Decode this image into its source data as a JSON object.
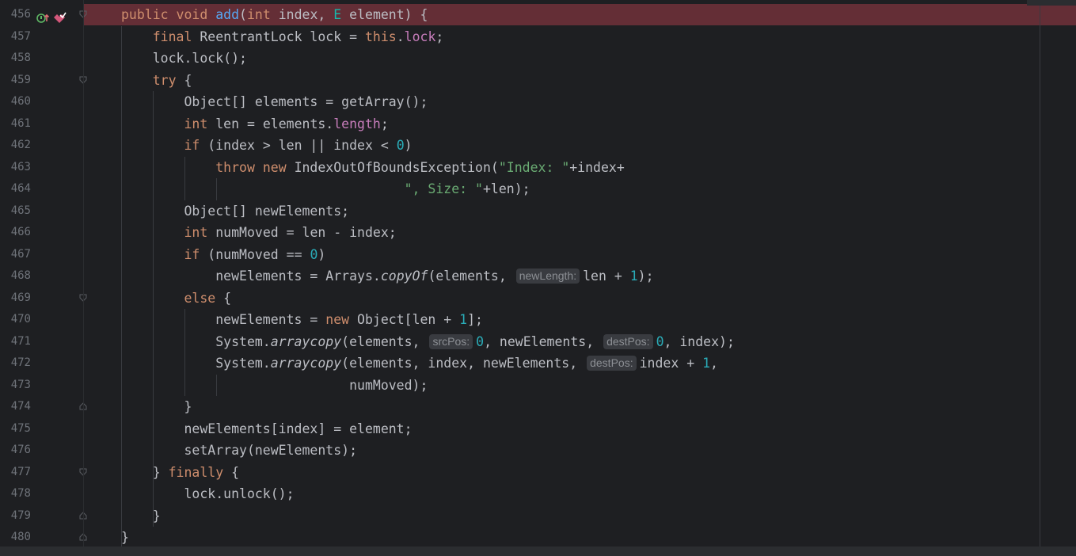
{
  "editor": {
    "lines": [
      {
        "num": "456",
        "segments": [
          [
            "kw",
            "public void "
          ],
          [
            "mth",
            "add"
          ],
          [
            "",
            "("
          ],
          [
            "kw",
            "int "
          ],
          [
            "",
            "index, "
          ],
          [
            "tp",
            "E "
          ],
          [
            "",
            "element) {"
          ]
        ]
      },
      {
        "num": "457",
        "segments": [
          [
            "",
            "    "
          ],
          [
            "kw",
            "final "
          ],
          [
            "",
            "ReentrantLock lock = "
          ],
          [
            "kw",
            "this"
          ],
          [
            "",
            "."
          ],
          [
            "fld",
            "lock"
          ],
          [
            "",
            ";"
          ]
        ]
      },
      {
        "num": "458",
        "segments": [
          [
            "",
            "    lock.lock();"
          ]
        ]
      },
      {
        "num": "459",
        "segments": [
          [
            "",
            "    "
          ],
          [
            "kw",
            "try "
          ],
          [
            "",
            "{"
          ]
        ]
      },
      {
        "num": "460",
        "segments": [
          [
            "",
            "        Object[] elements = getArray();"
          ]
        ]
      },
      {
        "num": "461",
        "segments": [
          [
            "",
            "        "
          ],
          [
            "kw",
            "int "
          ],
          [
            "",
            "len = elements."
          ],
          [
            "fld",
            "length"
          ],
          [
            "",
            ";"
          ]
        ]
      },
      {
        "num": "462",
        "segments": [
          [
            "",
            "        "
          ],
          [
            "kw",
            "if "
          ],
          [
            "",
            "(index > len || index < "
          ],
          [
            "num",
            "0"
          ],
          [
            "",
            ")"
          ]
        ]
      },
      {
        "num": "463",
        "segments": [
          [
            "",
            "            "
          ],
          [
            "kw",
            "throw new "
          ],
          [
            "",
            "IndexOutOfBoundsException("
          ],
          [
            "str",
            "\"Index: \""
          ],
          [
            "",
            "+index+"
          ]
        ]
      },
      {
        "num": "464",
        "segments": [
          [
            "",
            "                                    "
          ],
          [
            "str",
            "\", Size: \""
          ],
          [
            "",
            "+len);"
          ]
        ]
      },
      {
        "num": "465",
        "segments": [
          [
            "",
            "        Object[] newElements;"
          ]
        ]
      },
      {
        "num": "466",
        "segments": [
          [
            "",
            "        "
          ],
          [
            "kw",
            "int "
          ],
          [
            "",
            "numMoved = len - index;"
          ]
        ]
      },
      {
        "num": "467",
        "segments": [
          [
            "",
            "        "
          ],
          [
            "kw",
            "if "
          ],
          [
            "",
            "(numMoved == "
          ],
          [
            "num",
            "0"
          ],
          [
            "",
            ")"
          ]
        ]
      },
      {
        "num": "468",
        "segments": [
          [
            "",
            "            newElements = Arrays."
          ],
          [
            "static-m",
            "copyOf"
          ],
          [
            "",
            "(elements, "
          ],
          [
            "hint",
            "newLength:"
          ],
          [
            "",
            "len + "
          ],
          [
            "num",
            "1"
          ],
          [
            "",
            ");"
          ]
        ]
      },
      {
        "num": "469",
        "segments": [
          [
            "",
            "        "
          ],
          [
            "kw",
            "else "
          ],
          [
            "",
            "{"
          ]
        ]
      },
      {
        "num": "470",
        "segments": [
          [
            "",
            "            newElements = "
          ],
          [
            "kw",
            "new "
          ],
          [
            "",
            "Object[len + "
          ],
          [
            "num",
            "1"
          ],
          [
            "",
            "];"
          ]
        ]
      },
      {
        "num": "471",
        "segments": [
          [
            "",
            "            System."
          ],
          [
            "static-m",
            "arraycopy"
          ],
          [
            "",
            "(elements, "
          ],
          [
            "hint",
            "srcPos:"
          ],
          [
            "num",
            "0"
          ],
          [
            "",
            ", newElements, "
          ],
          [
            "hint",
            "destPos:"
          ],
          [
            "num",
            "0"
          ],
          [
            "",
            ", index);"
          ]
        ]
      },
      {
        "num": "472",
        "segments": [
          [
            "",
            "            System."
          ],
          [
            "static-m",
            "arraycopy"
          ],
          [
            "",
            "(elements, index, newElements, "
          ],
          [
            "hint",
            "destPos:"
          ],
          [
            "",
            "index + "
          ],
          [
            "num",
            "1"
          ],
          [
            "",
            ","
          ]
        ]
      },
      {
        "num": "473",
        "segments": [
          [
            "",
            "                             numMoved);"
          ]
        ]
      },
      {
        "num": "474",
        "segments": [
          [
            "",
            "        }"
          ]
        ]
      },
      {
        "num": "475",
        "segments": [
          [
            "",
            "        newElements[index] = element;"
          ]
        ]
      },
      {
        "num": "476",
        "segments": [
          [
            "",
            "        setArray(newElements);"
          ]
        ]
      },
      {
        "num": "477",
        "segments": [
          [
            "",
            "    } "
          ],
          [
            "kw",
            "finally "
          ],
          [
            "",
            "{"
          ]
        ]
      },
      {
        "num": "478",
        "segments": [
          [
            "",
            "        lock.unlock();"
          ]
        ]
      },
      {
        "num": "479",
        "segments": [
          [
            "",
            "    }"
          ]
        ]
      },
      {
        "num": "480",
        "segments": [
          [
            "",
            "}"
          ]
        ]
      }
    ],
    "highlighted_line": "456",
    "gutter_icons": [
      "override-up-icon",
      "bookmark-check-icon"
    ],
    "colors": {
      "background": "#1e1f22",
      "highlight": "#642e36",
      "keyword": "#cf8e6d",
      "field": "#c77dbb",
      "method": "#56a8f5",
      "number": "#2aacb8",
      "string": "#6aab73"
    }
  }
}
